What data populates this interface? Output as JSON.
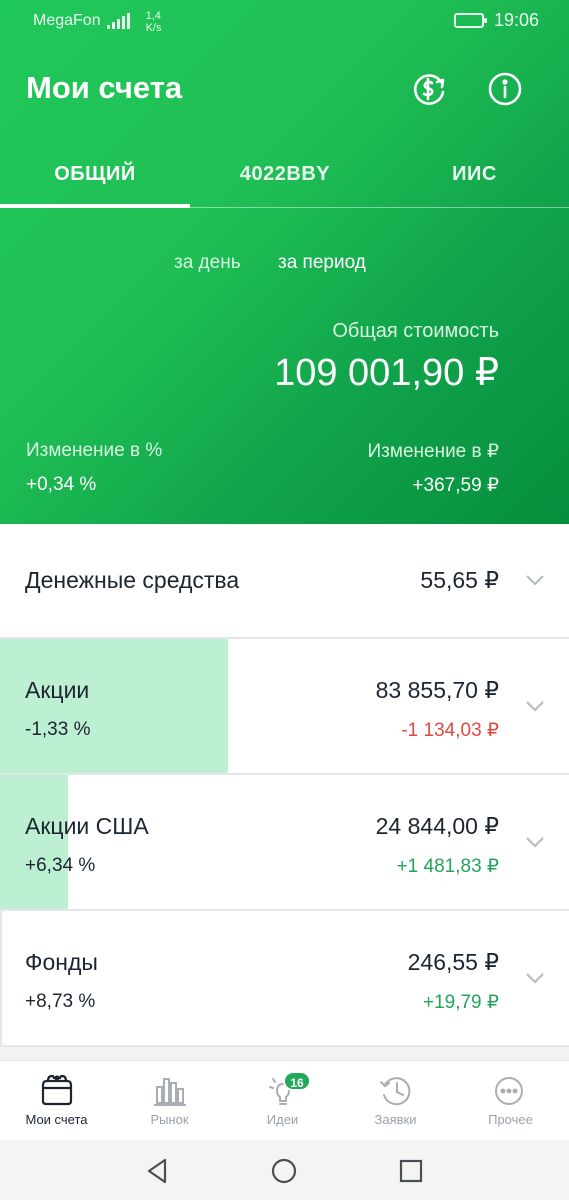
{
  "status": {
    "carrier": "MegaFon",
    "speed_value": "1,4",
    "speed_unit": "K/s",
    "time": "19:06"
  },
  "header": {
    "title": "Мои счета",
    "icons": {
      "exchange": "dollar-refresh-icon",
      "info": "info-icon"
    }
  },
  "tabs": [
    {
      "label": "ОБЩИЙ",
      "active": true
    },
    {
      "label": "4022BBY",
      "active": false
    },
    {
      "label": "ИИС",
      "active": false
    }
  ],
  "period": {
    "day": "за день",
    "range": "за период",
    "selected": "range"
  },
  "summary": {
    "total_label": "Общая стоимость",
    "total_value": "109 001,90 ₽",
    "change_pct_label": "Изменение в  %",
    "change_pct_value": "+0,34  %",
    "change_rub_label": "Изменение в ₽",
    "change_rub_value": "+367,59 ₽"
  },
  "rows": [
    {
      "name": "Денежные средства",
      "amount": "55,65 ₽"
    },
    {
      "name": "Акции",
      "pct": "-1,33  %",
      "amount": "83 855,70 ₽",
      "delta": "-1 134,03 ₽",
      "delta_sign": "negative",
      "share": 0.77
    },
    {
      "name": "Акции США",
      "pct": "+6,34  %",
      "amount": "24 844,00 ₽",
      "delta": "+1 481,83 ₽",
      "delta_sign": "positive",
      "share": 0.23
    },
    {
      "name": "Фонды",
      "pct": "+8,73  %",
      "amount": "246,55 ₽",
      "delta": "+19,79 ₽",
      "delta_sign": "positive",
      "share": 0.0
    }
  ],
  "colors": {
    "accent": "#21c85a",
    "accent_dark": "#068e3d",
    "share_bar": "#bdf0d3",
    "negative": "#e4473e",
    "positive": "#22a55a"
  },
  "bottom_nav": [
    {
      "label": "Мои счета",
      "icon": "wallet-icon",
      "active": true
    },
    {
      "label": "Рынок",
      "icon": "bar-chart-icon",
      "active": false
    },
    {
      "label": "Идеи",
      "icon": "lightbulb-icon",
      "active": false,
      "badge": "16"
    },
    {
      "label": "Заявки",
      "icon": "history-clock-icon",
      "active": false
    },
    {
      "label": "Прочее",
      "icon": "more-dots-icon",
      "active": false
    }
  ]
}
